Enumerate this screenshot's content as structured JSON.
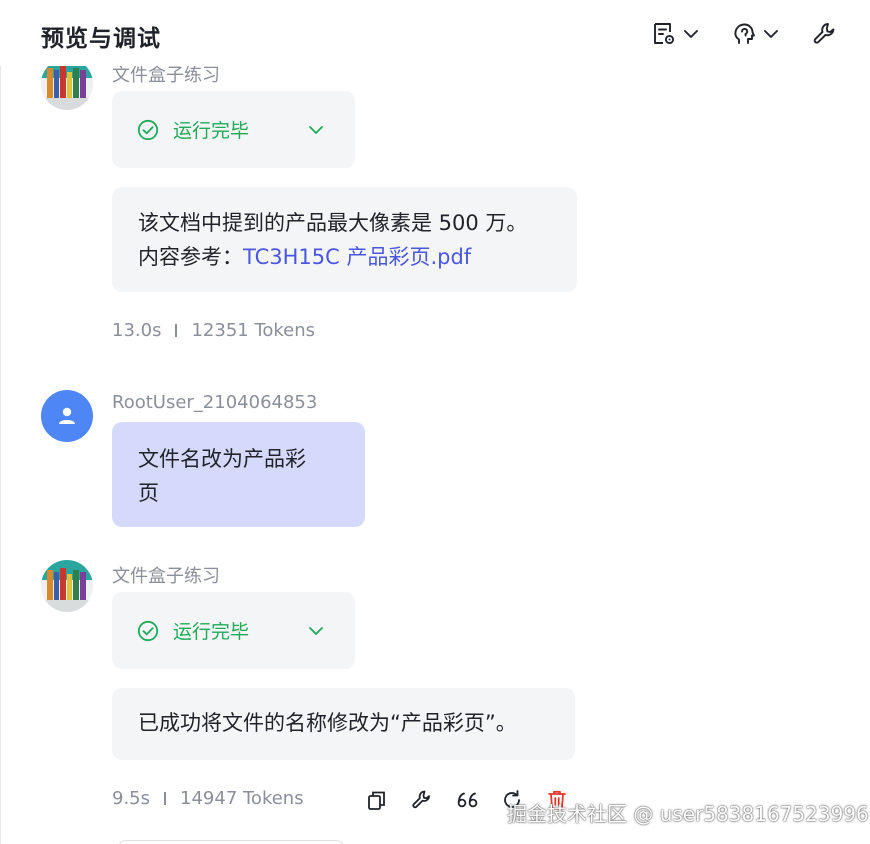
{
  "header": {
    "title": "预览与调试"
  },
  "messages": {
    "bot1": {
      "sender": "文件盒子练习",
      "status": "运行完毕",
      "answer_line1": "该文档中提到的产品最大像素是 500 万。",
      "ref_label": "内容参考：",
      "ref_file": "TC3H15C 产品彩页.pdf",
      "time": "13.0s",
      "tokens": "12351 Tokens"
    },
    "user1": {
      "sender": "RootUser_2104064853",
      "text_line1": "文件名改为产品彩",
      "text_line2": "页"
    },
    "bot2": {
      "sender": "文件盒子练习",
      "status": "运行完毕",
      "answer": "已成功将文件的名称修改为“产品彩页”。",
      "time": "9.5s",
      "tokens": "14947 Tokens"
    }
  },
  "watermark": "掘金技术社区 @ user5838167523996",
  "colors": {
    "success": "#1faa58",
    "link": "#4a57e0",
    "user_bubble": "#d5dafd",
    "avatar_user": "#4e86f6"
  }
}
